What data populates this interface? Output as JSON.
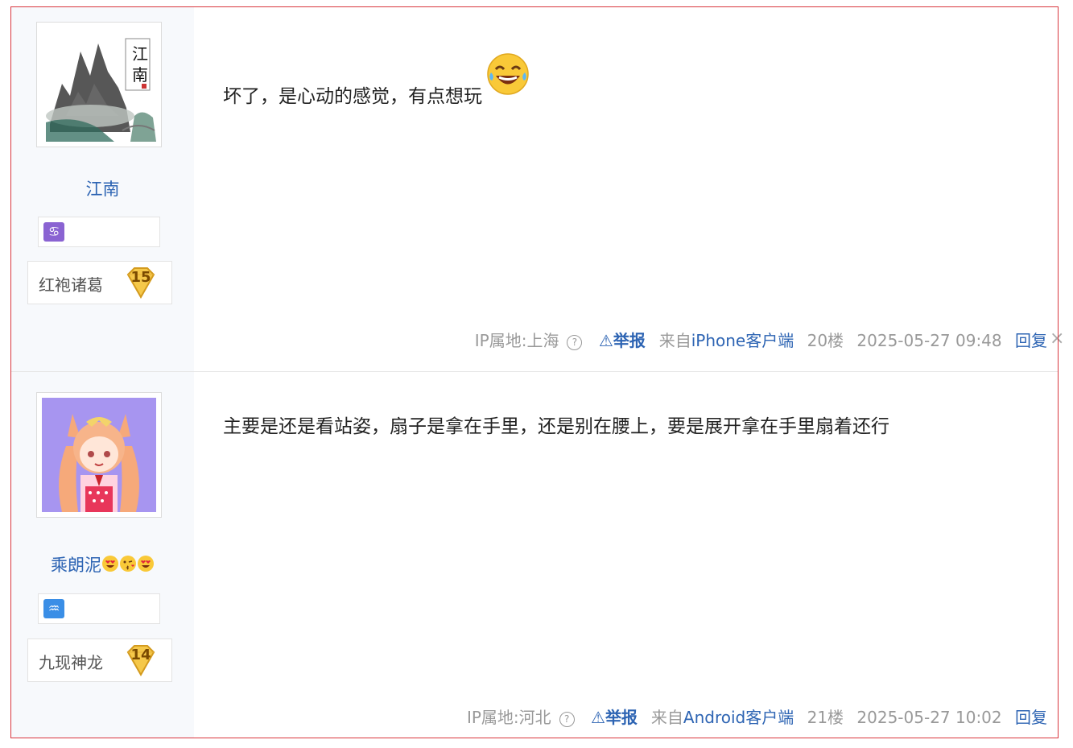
{
  "posts": [
    {
      "username": "江南",
      "username_emojis": [],
      "zodiac_icon": "cancer-zodiac-icon",
      "zodiac_color": "#8a63d2",
      "level_title": "红袍诸葛",
      "level": "15",
      "content": "坏了，是心动的感觉，有点想玩",
      "content_emoji": "laughing-tears-emoji",
      "ip": "IP属地:上海",
      "report_label": "举报",
      "client_prefix": "来自",
      "client_name": "iPhone客户端",
      "floor": "20楼",
      "time": "2025-05-27 09:48",
      "reply_label": "回复"
    },
    {
      "username": "乘朗泥",
      "username_emojis": [
        "heart-eyes-emoji",
        "kissing-emoji",
        "heart-eyes-emoji"
      ],
      "zodiac_icon": "aquarius-zodiac-icon",
      "zodiac_color": "#3a8ee6",
      "level_title": "九现神龙",
      "level": "14",
      "content": "主要是还是看站姿，扇子是拿在手里，还是别在腰上，要是展开拿在手里扇着还行",
      "ip": "IP属地:河北",
      "report_label": "举报",
      "client_prefix": "来自",
      "client_name": "Android客户端",
      "floor": "21楼",
      "time": "2025-05-27 10:02",
      "reply_label": "回复"
    }
  ],
  "colors": {
    "link": "#2d64b3",
    "meta": "#999999",
    "sidebar_bg": "#f7f9fc",
    "frame": "#d9363e"
  }
}
